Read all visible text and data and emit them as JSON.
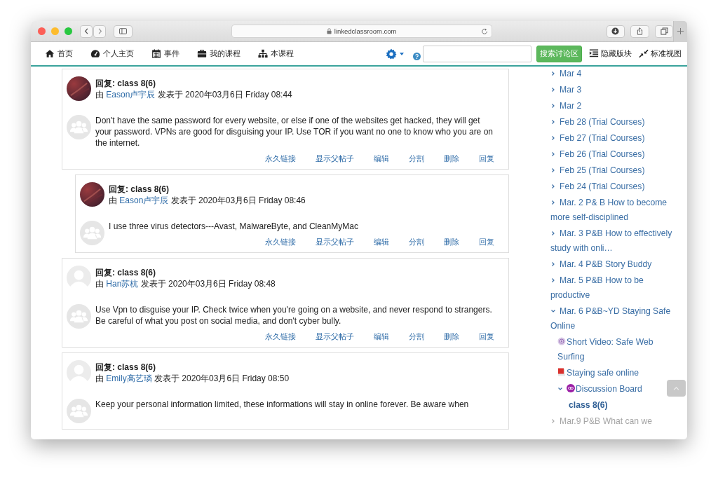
{
  "browser": {
    "address": "linkedclassroom.com"
  },
  "nav": {
    "items": [
      {
        "kind": "home",
        "label": "首页"
      },
      {
        "kind": "dashboard",
        "label": "个人主页"
      },
      {
        "kind": "calendar",
        "label": "事件"
      },
      {
        "kind": "briefcase",
        "label": "我的课程"
      },
      {
        "kind": "sitemap",
        "label": "本课程"
      }
    ],
    "search_button": "搜索讨论区",
    "actions": [
      {
        "kind": "hide",
        "label": "隐藏版块"
      },
      {
        "kind": "standard",
        "label": "标准视图"
      }
    ]
  },
  "posts": [
    {
      "subject": "回复: class 8(6)",
      "by": "由",
      "author": "Eason卢宇辰",
      "posted": "发表于 2020年03月6日 Friday 08:44",
      "avatar": {
        "kind": "photo"
      },
      "message": "Don't have the same password for every website, or else if one of the websites get hacked, they will get your password. VPNs are good for disguising your IP. Use TOR if you want no one to know who you are on the internet.",
      "actions": [
        "永久链接",
        "显示父帖子",
        "编辑",
        "分割",
        "删除",
        "回复"
      ],
      "replies": [
        {
          "subject": "回复: class 8(6)",
          "by": "由",
          "author": "Eason卢宇辰",
          "posted": "发表于 2020年03月6日 Friday 08:46",
          "avatar": {
            "kind": "photo"
          },
          "message": "I use three virus detectors---Avast, MalwareByte, and CleanMyMac",
          "actions": [
            "永久链接",
            "显示父帖子",
            "编辑",
            "分割",
            "删除",
            "回复"
          ]
        }
      ]
    },
    {
      "subject": "回复: class 8(6)",
      "by": "由",
      "author": "Han苏杭",
      "posted": "发表于 2020年03月6日 Friday 08:48",
      "avatar": {
        "kind": "default"
      },
      "message": "Use Vpn to disguise your IP. Check twice when you're going on a website, and never respond to strangers. Be careful of what you post on social media, and don't cyber bully.",
      "actions": [
        "永久链接",
        "显示父帖子",
        "编辑",
        "分割",
        "删除",
        "回复"
      ]
    },
    {
      "subject": "回复: class 8(6)",
      "by": "由",
      "author": "Emily高艺璘",
      "posted": "发表于 2020年03月6日 Friday 08:50",
      "avatar": {
        "kind": "default"
      },
      "message": "Keep your personal information limited, these informations will stay in online forever. Be aware when"
    }
  ],
  "sidebar": {
    "items": [
      {
        "label": "Mar 4",
        "expanded": false,
        "dimmed": false
      },
      {
        "label": "Mar 3",
        "expanded": false,
        "dimmed": false
      },
      {
        "label": "Mar 2",
        "expanded": false,
        "dimmed": false
      },
      {
        "label": "Feb 28 (Trial Courses)",
        "expanded": false,
        "dimmed": false
      },
      {
        "label": "Feb 27 (Trial Courses)",
        "expanded": false,
        "dimmed": false
      },
      {
        "label": "Feb 26 (Trial Courses)",
        "expanded": false,
        "dimmed": false
      },
      {
        "label": "Feb 25 (Trial Courses)",
        "expanded": false,
        "dimmed": false
      },
      {
        "label": "Feb 24 (Trial Courses)",
        "expanded": false,
        "dimmed": false
      },
      {
        "label": "Mar. 2 P& B How to become more self-disciplined",
        "expanded": false,
        "dimmed": false
      },
      {
        "label": "Mar. 3 P&B How to effectively study with onli…",
        "expanded": false,
        "dimmed": false
      },
      {
        "label": "Mar. 4 P&B Story Buddy",
        "expanded": false,
        "dimmed": false
      },
      {
        "label": "Mar. 5 P&B How to be productive",
        "expanded": false,
        "dimmed": false
      },
      {
        "label": "Mar. 6 P&B~YD Staying Safe Online",
        "expanded": true,
        "dimmed": false,
        "children": [
          {
            "kind": "video",
            "label": "Short Video: Safe Web Surfing"
          },
          {
            "kind": "file",
            "label": "Staying safe online"
          },
          {
            "kind": "forum",
            "label": "Discussion Board",
            "expanded": true,
            "children": [
              {
                "label": "class 8(6)",
                "selected": true
              }
            ]
          }
        ]
      },
      {
        "label": "Mar.9 P&B What can we",
        "expanded": false,
        "dimmed": true
      }
    ]
  }
}
